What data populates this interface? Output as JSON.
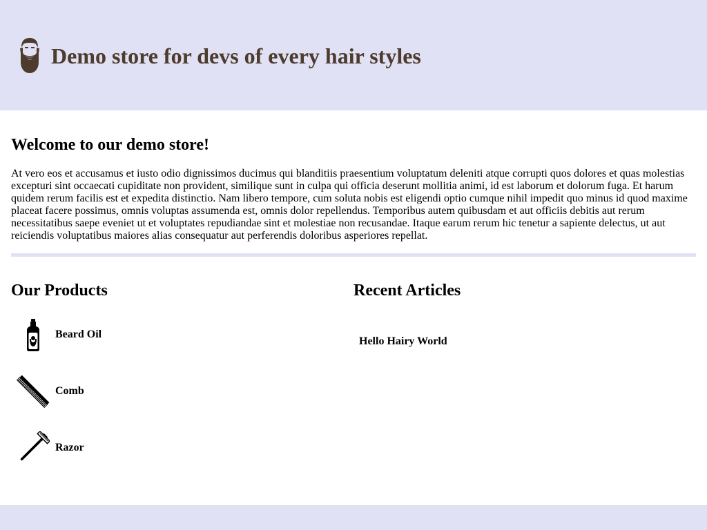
{
  "header": {
    "logo_icon": "bearded-man-icon",
    "title": "Demo store for devs of every hair styles",
    "background_color": "#e0e1f5",
    "title_color": "#4d3b2d"
  },
  "welcome": {
    "title": "Welcome to our demo store!",
    "body": "At vero eos et accusamus et iusto odio dignissimos ducimus qui blanditiis praesentium voluptatum deleniti atque corrupti quos dolores et quas molestias excepturi sint occaecati cupiditate non provident, similique sunt in culpa qui officia deserunt mollitia animi, id est laborum et dolorum fuga. Et harum quidem rerum facilis est et expedita distinctio. Nam libero tempore, cum soluta nobis est eligendi optio cumque nihil impedit quo minus id quod maxime placeat facere possimus, omnis voluptas assumenda est, omnis dolor repellendus. Temporibus autem quibusdam et aut officiis debitis aut rerum necessitatibus saepe eveniet ut et voluptates repudiandae sint et molestiae non recusandae. Itaque earum rerum hic tenetur a sapiente delectus, ut aut reiciendis voluptatibus maiores alias consequatur aut perferendis doloribus asperiores repellat."
  },
  "products": {
    "title": "Our Products",
    "items": [
      {
        "name": "Beard Oil",
        "icon": "beard-oil-bottle-icon"
      },
      {
        "name": "Comb",
        "icon": "comb-icon"
      },
      {
        "name": "Razor",
        "icon": "razor-icon"
      }
    ]
  },
  "articles": {
    "title": "Recent Articles",
    "items": [
      {
        "title": "Hello Hairy World"
      }
    ]
  }
}
